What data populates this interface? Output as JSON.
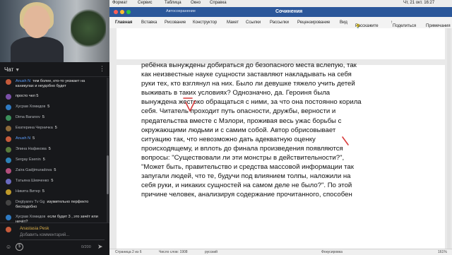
{
  "menubar": {
    "items": [
      "Формат",
      "Сервис",
      "Таблица",
      "Окно",
      "Справка"
    ],
    "clock": "Чт, 21 окт. 16:27"
  },
  "titlebar": {
    "title": "Сочинения",
    "autosave": "Автосохранение"
  },
  "ribbon": {
    "tabs": [
      "Главная",
      "Вставка",
      "Рисование",
      "Конструктор",
      "Макет",
      "Ссылки",
      "Рассылки",
      "Рецензирование",
      "Вид",
      "Расскажите"
    ],
    "share": "Поделиться",
    "comments": "Примечания"
  },
  "chat": {
    "title": "Чат",
    "messages": [
      {
        "name": "Anush N",
        "name_color": "blue",
        "text": "тем более, кто-то уезжает на каникулах и неудобно будет",
        "avatar_color": "#c65b3b"
      },
      {
        "name": "",
        "text": "просто чел 5",
        "avatar_color": "#7a4fa8"
      },
      {
        "name": "Хусрав Хомидов",
        "name_color": "gray",
        "text": "5",
        "avatar_color": "#2e7ac2"
      },
      {
        "name": "Dima Baranov",
        "name_color": "gray",
        "text": "5",
        "avatar_color": "#3c8f5a"
      },
      {
        "name": "Екатерина Черничка",
        "name_color": "gray",
        "text": "5",
        "avatar_color": "#8d6a3a"
      },
      {
        "name": "Anush N",
        "name_color": "blue",
        "text": "5",
        "avatar_color": "#c65b3b"
      },
      {
        "name": "Элина Нафикова",
        "name_color": "gray",
        "text": "5",
        "avatar_color": "#5a7c3c"
      },
      {
        "name": "Sergay Esenin",
        "name_color": "gray",
        "text": "5",
        "avatar_color": "#2d82b7"
      },
      {
        "name": "Zaira Gadjimuradova",
        "name_color": "gray",
        "text": "5",
        "avatar_color": "#b34e7c"
      },
      {
        "name": "Татьяна Шевченко",
        "name_color": "gray",
        "text": "5",
        "avatar_color": "#6a6ac0"
      },
      {
        "name": "Никита Витер",
        "name_color": "gray",
        "text": "5",
        "avatar_color": "#c09a2a"
      },
      {
        "name": "Degtyarev Tv Gg",
        "name_color": "gray",
        "text": "изумительно перфекто бесподобно",
        "avatar_color": "#444444"
      },
      {
        "name": "Хусрав Хомидов",
        "name_color": "gray",
        "text": "если будет 3 , это зачёт или нечёт?",
        "avatar_color": "#2e7ac2"
      }
    ],
    "input": {
      "name": "Anastasia Pesk",
      "placeholder": "Добавить комментарий...",
      "count": "0/200"
    }
  },
  "document": {
    "lines": [
      "ребёнка вынуждены добираться до безопасного места вслепую, так",
      "как неизвестные науке сущности заставляют накладывать на себя",
      "руки тех, кто взглянул на них. Было ли девушке тяжело учить детей",
      "выживать в таких условиях? Однозначно, да. Героиня была",
      "вынуждена жестоко обращаться с ними, за что она постоянно корила",
      "себя. Читатель проходит путь опасности, дружбы, верности и",
      "предательства вместе с Мэлори, проживая весь ужас борьбы с",
      "окружающими людьми и с самим собой. Автор обрисовывает",
      "ситуацию так, что невозможно дать адекватную оценку",
      "происходящему, и вплоть до финала произведения появляются",
      "вопросы: \"Существовали ли эти монстры в действительности?\",",
      "\"Может быть, правительство и средства массовой информации так",
      "запугали людей, что те, будучи под влиянием толпы, наложили на",
      "себя руки, и никаких сущностей на самом деле не было?\". По этой",
      "причине человек, анализируя содержание прочитанного, способен"
    ],
    "ink_color": "#d83a3a"
  },
  "status": {
    "page": "Страница 2 из 6",
    "words": "Число слов: 1908",
    "language": "русский",
    "focus": "Фокусировка",
    "zoom": "161%"
  },
  "colors": {
    "word_blue": "#2b579a",
    "chat_bg": "#17181b"
  }
}
